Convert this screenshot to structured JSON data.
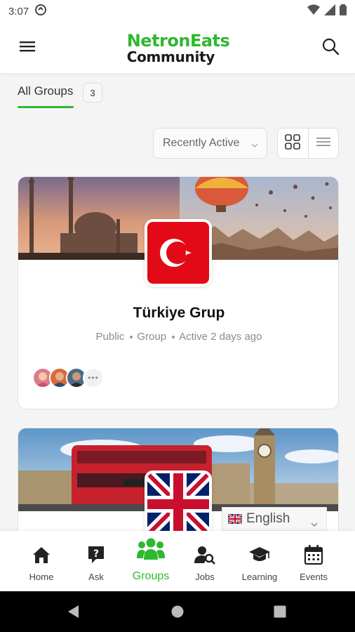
{
  "status_bar": {
    "time": "3:07"
  },
  "header": {
    "logo_line1": "NetronEats",
    "logo_line2": "Community",
    "menu_icon": "hamburger-menu-icon",
    "search_icon": "search-icon"
  },
  "tabs": {
    "all_groups_label": "All Groups",
    "all_groups_count": "3"
  },
  "filters": {
    "sort_label": "Recently Active",
    "view_grid_icon": "grid-view-icon",
    "view_list_icon": "list-view-icon"
  },
  "groups": [
    {
      "name": "Türkiye Grup",
      "privacy": "Public",
      "type": "Group",
      "activity": "Active 2 days ago",
      "flag": "turkey-flag"
    },
    {
      "flag": "uk-flag"
    }
  ],
  "language_selector": {
    "label": "English"
  },
  "bottom_nav": {
    "items": [
      {
        "label": "Home",
        "icon": "home-icon"
      },
      {
        "label": "Ask",
        "icon": "question-icon"
      },
      {
        "label": "Groups",
        "icon": "groups-icon"
      },
      {
        "label": "Jobs",
        "icon": "jobs-icon"
      },
      {
        "label": "Learning",
        "icon": "graduation-cap-icon"
      },
      {
        "label": "Events",
        "icon": "calendar-icon"
      }
    ]
  },
  "colors": {
    "accent": "#2eb82e",
    "turkey_red": "#e30a17",
    "uk_blue": "#012169",
    "uk_red": "#c8102e"
  }
}
